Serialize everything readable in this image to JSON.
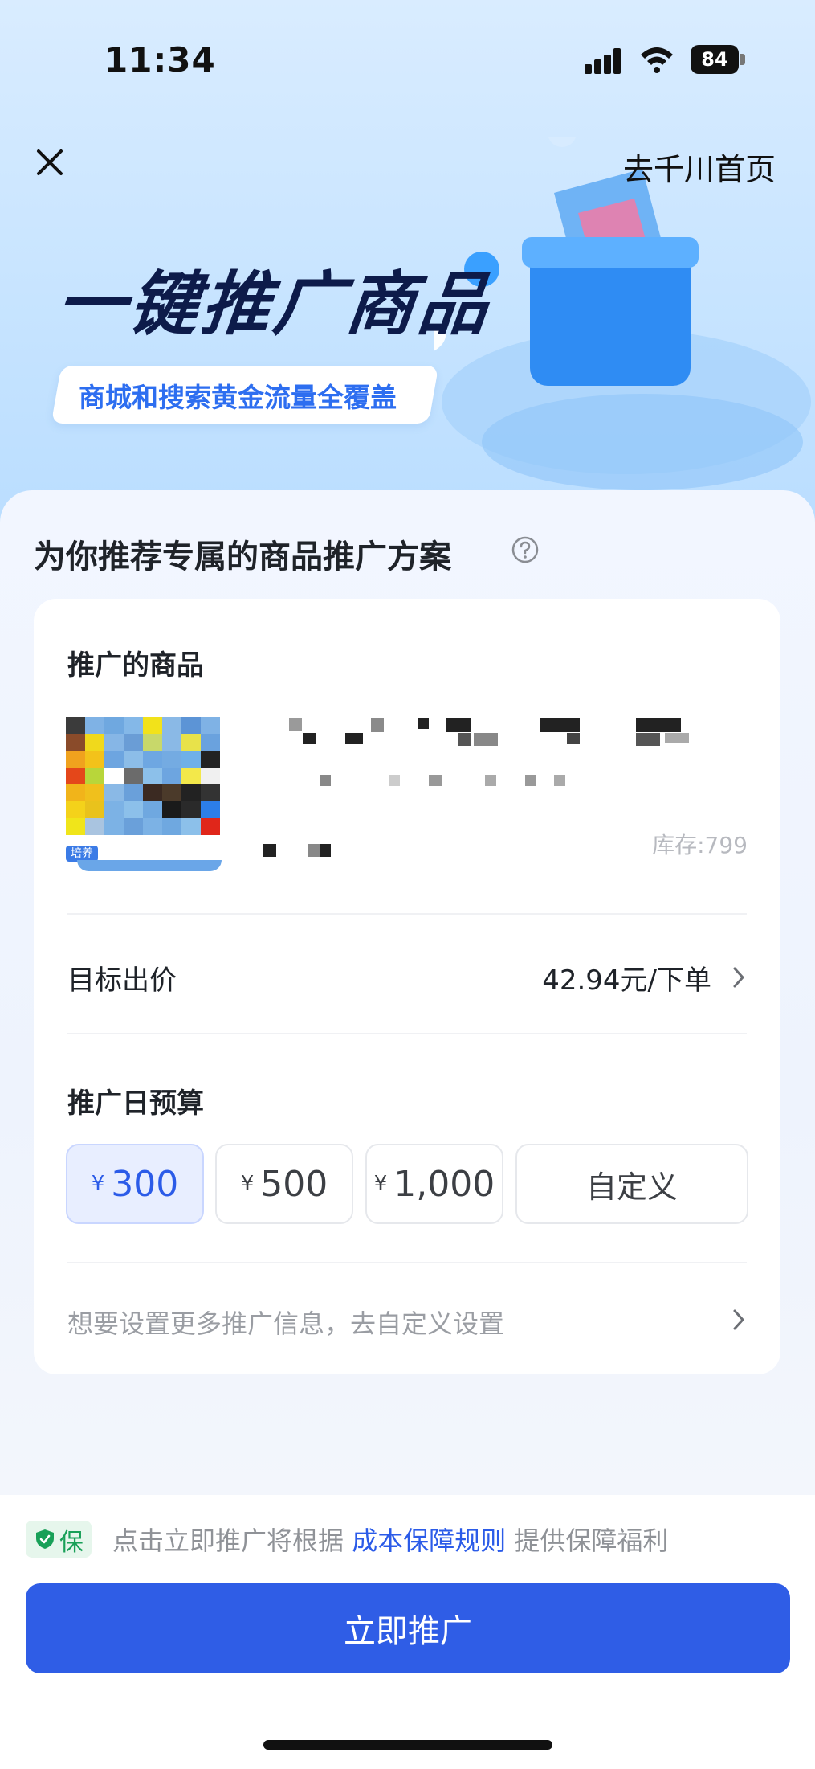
{
  "status_bar": {
    "time": "11:34",
    "battery": "84"
  },
  "header": {
    "home_link": "去千川首页",
    "title": "一键推广商品",
    "subtitle": "商城和搜索黄金流量全覆盖"
  },
  "plan": {
    "title": "为你推荐专属的商品推广方案",
    "product_label": "推广的商品",
    "thumb_tag": "培养",
    "stock": "库存:799",
    "bid_label": "目标出价",
    "bid_value": "42.94元/下单",
    "budget_label": "推广日预算",
    "currency_symbol": "¥",
    "budget_options": [
      {
        "amount": "300",
        "selected": true
      },
      {
        "amount": "500",
        "selected": false
      },
      {
        "amount": "1,000",
        "selected": false
      }
    ],
    "custom_label": "自定义",
    "more_settings": "想要设置更多推广信息，去自定义设置"
  },
  "footer": {
    "badge": "保",
    "notice_prefix": "点击立即推广将根据",
    "notice_link": "成本保障规则",
    "notice_suffix": "提供保障福利",
    "cta": "立即推广"
  },
  "colors": {
    "primary": "#2f5de6",
    "accent_text": "#2b5be8",
    "guarantee": "#18a058"
  }
}
